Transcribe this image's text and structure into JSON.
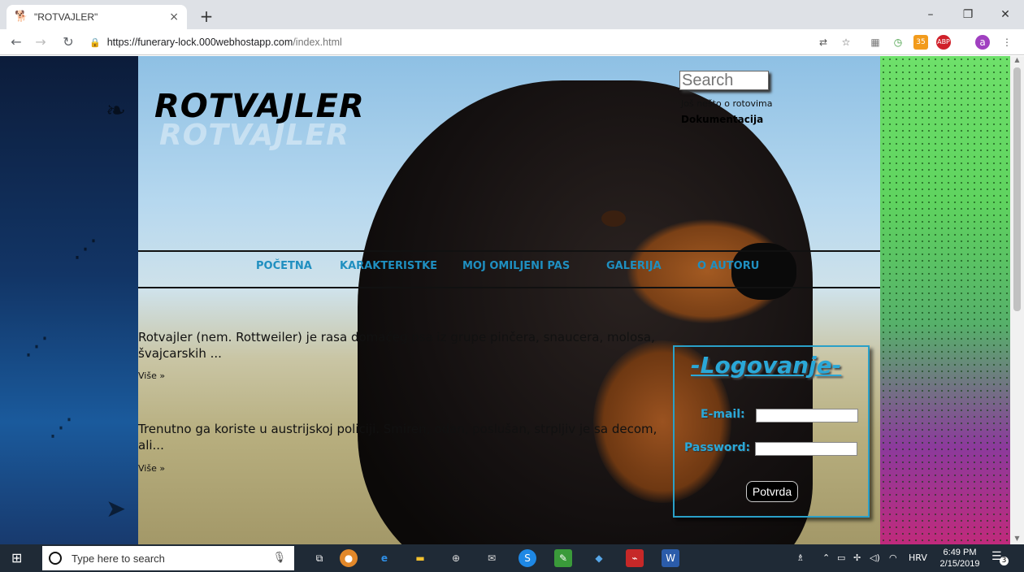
{
  "browser": {
    "tab_title": "\"ROTVAJLER\"",
    "tab_close": "×",
    "new_tab": "+",
    "url_host": "https://funerary-lock.000webhostapp.com",
    "url_path": "/index.html",
    "window_controls": {
      "minimize": "–",
      "restore": "❐",
      "close": "✕"
    },
    "extension_badge": "35",
    "profile_initial": "a"
  },
  "site": {
    "logo": "ROTVAJLER",
    "search_placeholder": "Search",
    "side_links": [
      "Još nešto o rotovima",
      "Dokumentacija"
    ],
    "nav": [
      "POČETNA",
      "KARAKTERISTKE",
      "MOJ OMILJENI PAS",
      "GALERIJA",
      "O AUTORU"
    ],
    "articles": [
      {
        "text": "Rotvajler (nem. Rottweiler) je rasa domaćeg psa iz grupe pinčera, snaucera, molosa, švajcarskih ...",
        "more": "Više »"
      },
      {
        "text": "Trenutno ga koriste u austrijskoj policiji. Smiren, odan, poslušan, strpljiv je sa decom, ali...",
        "more": "Više »"
      }
    ],
    "login": {
      "heading": "-Logovanje-",
      "email_label": "E-mail:",
      "password_label": "Password:",
      "submit": "Potvrda"
    }
  },
  "taskbar": {
    "search_placeholder": "Type here to search",
    "language": "HRV",
    "time": "6:49 PM",
    "date": "2/15/2019",
    "notification_count": "3"
  },
  "colors": {
    "nav_link": "#1f8fc0",
    "login_accent": "#2aa8d8",
    "taskbar_bg": "#1f2a36"
  }
}
